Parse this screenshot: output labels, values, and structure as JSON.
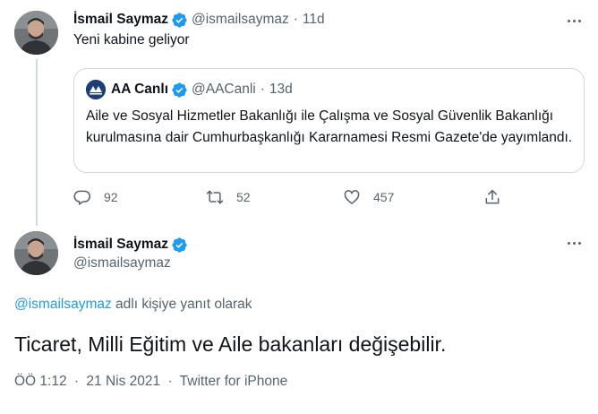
{
  "tweet1": {
    "author_name": "İsmail Saymaz",
    "handle": "@ismailsaymaz",
    "separator": "·",
    "time": "11d",
    "text": "Yeni kabine geliyor",
    "quote": {
      "author_name": "AA Canlı",
      "handle": "@AACanli",
      "separator": "·",
      "time": "13d",
      "text": "Aile ve Sosyal Hizmetler Bakanlığı ile Çalışma ve Sosyal Güvenlik Bakanlığı kurulmasına dair Cumhurbaşkanlığı Kararnamesi Resmi Gazete'de yayımlandı."
    },
    "actions": {
      "replies": "92",
      "retweets": "52",
      "likes": "457"
    }
  },
  "tweet2": {
    "author_name": "İsmail Saymaz",
    "handle": "@ismailsaymaz",
    "reply_to_handle": "@ismailsaymaz",
    "reply_to_suffix": " adlı kişiye yanıt olarak",
    "text": "Ticaret, Milli Eğitim ve Aile bakanları değişebilir.",
    "time": "ÖÖ 1:12",
    "separator1": "·",
    "date": "21 Nis 2021",
    "separator2": "·",
    "source": "Twitter for iPhone"
  },
  "icons": {
    "verified": "verified-badge-icon",
    "more": "more-icon",
    "reply": "reply-icon",
    "retweet": "retweet-icon",
    "like": "like-icon",
    "share": "share-icon"
  },
  "colors": {
    "accent": "#1d9bf0",
    "secondary_text": "#536471",
    "primary_text": "#0f1419",
    "border": "#cfd9de"
  }
}
